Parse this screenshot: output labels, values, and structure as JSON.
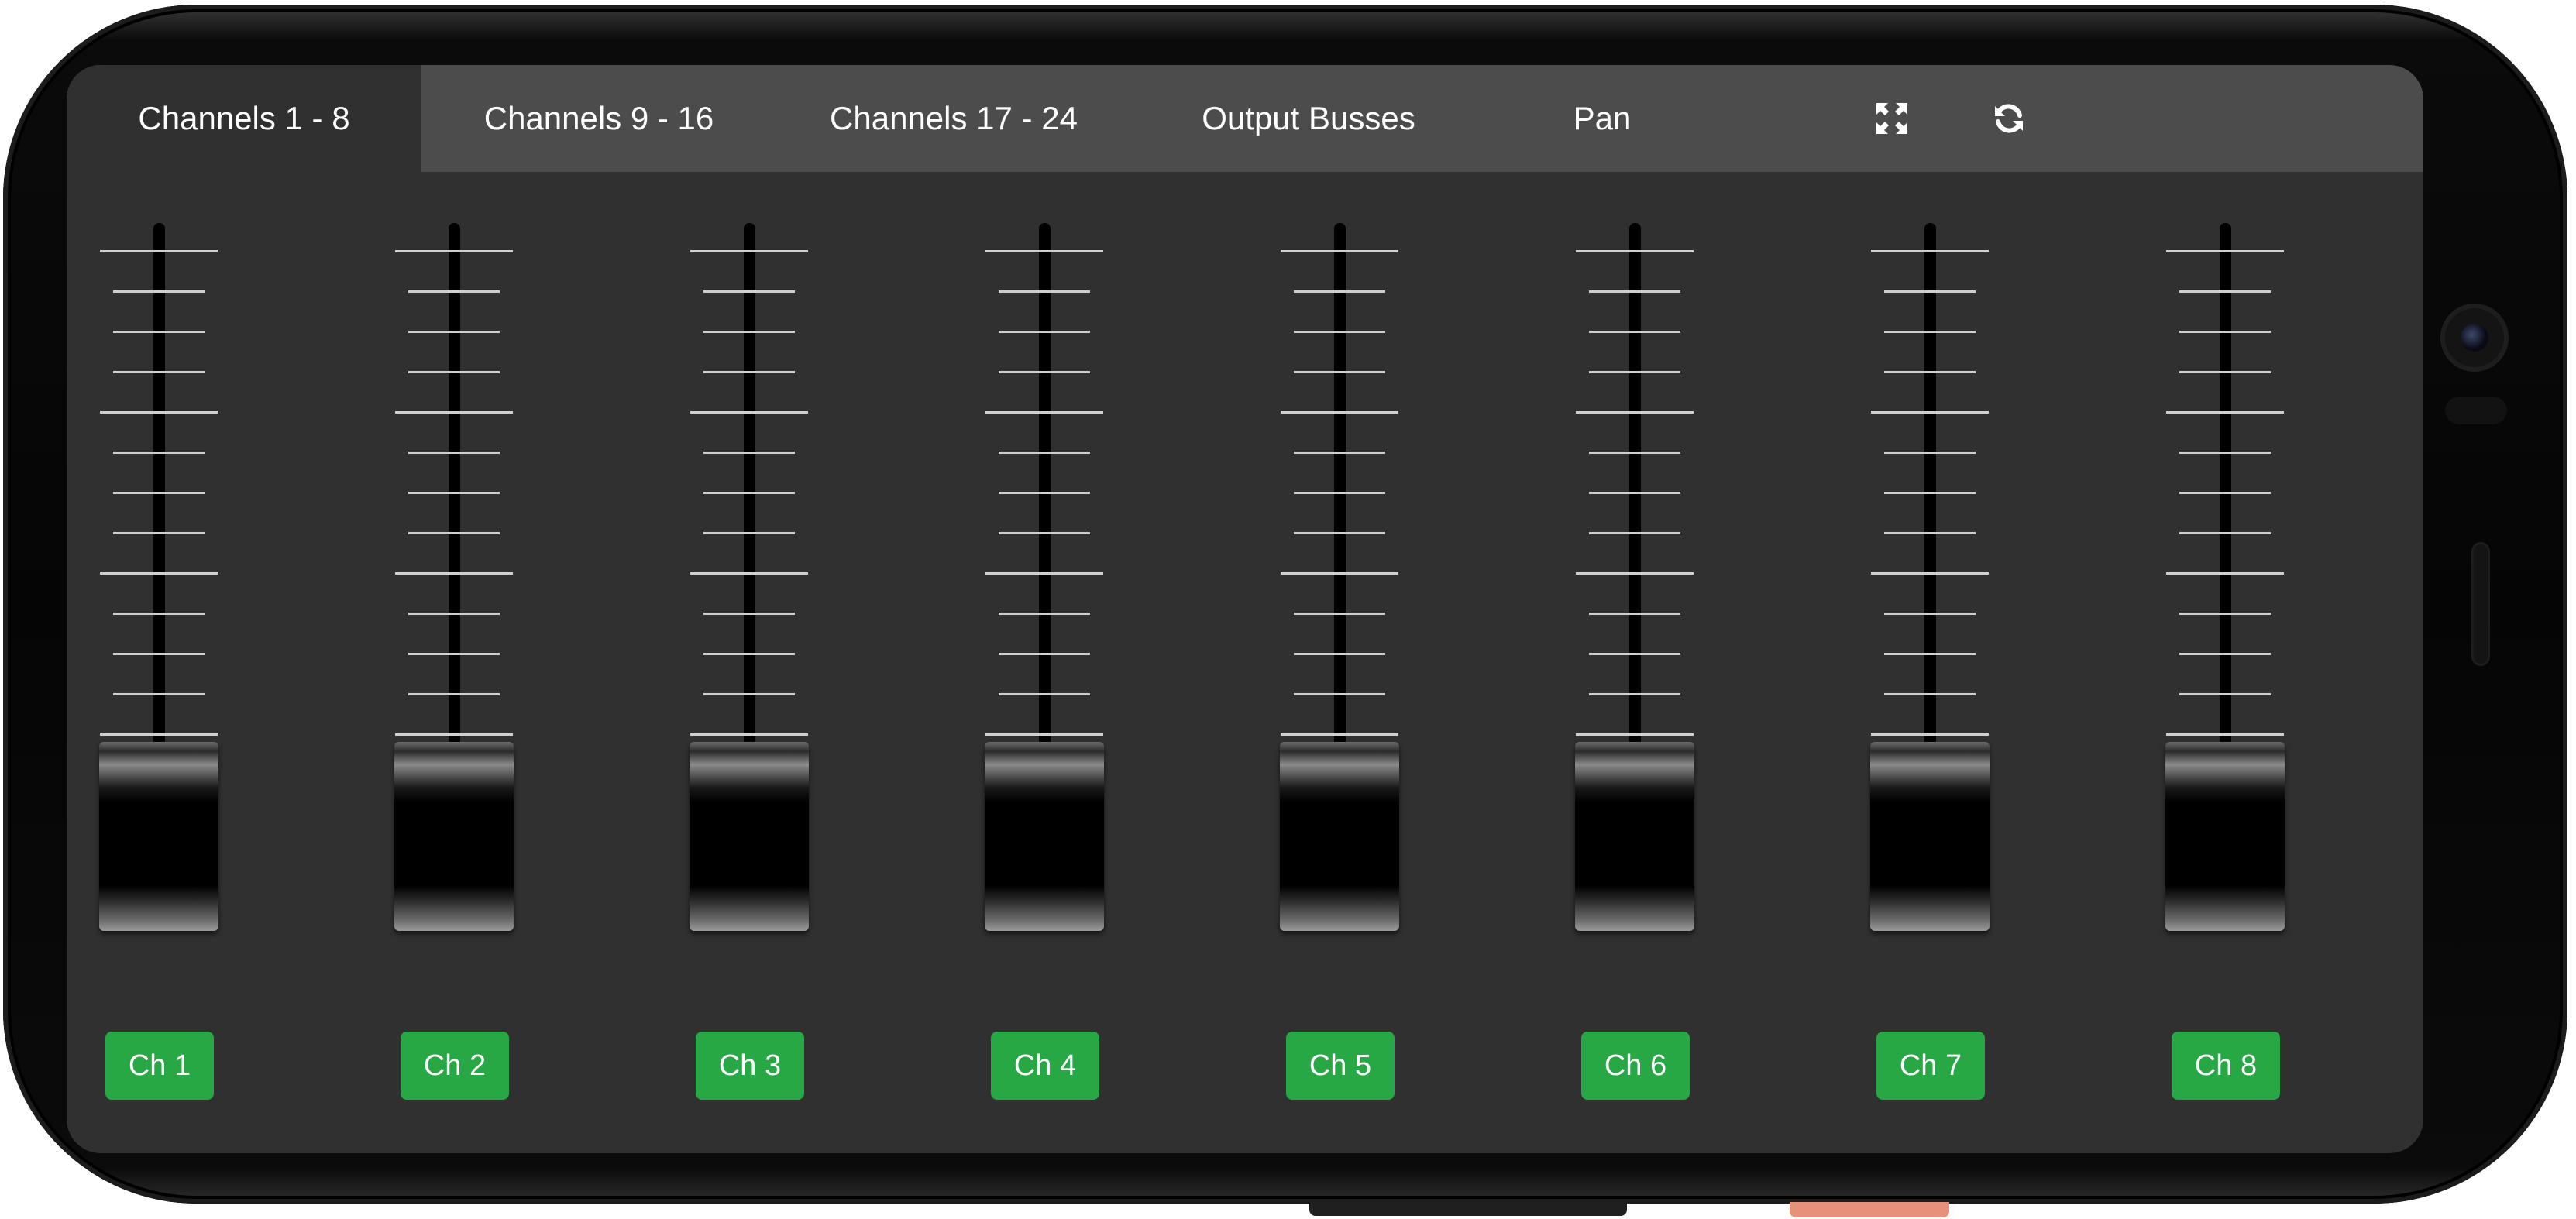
{
  "navbar": {
    "tabs": [
      {
        "label": "Channels 1 - 8",
        "active": true
      },
      {
        "label": "Channels 9 - 16",
        "active": false
      },
      {
        "label": "Channels 17 - 24",
        "active": false
      },
      {
        "label": "Output Busses",
        "active": false
      },
      {
        "label": "Pan",
        "active": false
      }
    ],
    "icons": [
      "fullscreen-icon",
      "refresh-icon"
    ]
  },
  "channels": [
    {
      "label": "Ch 1",
      "fader_level": 0
    },
    {
      "label": "Ch 2",
      "fader_level": 0
    },
    {
      "label": "Ch 3",
      "fader_level": 0
    },
    {
      "label": "Ch 4",
      "fader_level": 0
    },
    {
      "label": "Ch 5",
      "fader_level": 0
    },
    {
      "label": "Ch 6",
      "fader_level": 0
    },
    {
      "label": "Ch 7",
      "fader_level": 0
    },
    {
      "label": "Ch 8",
      "fader_level": 0
    }
  ],
  "colors": {
    "screen_bg": "#303030",
    "navbar_bg": "#4c4c4c",
    "channel_button": "#27a844",
    "tick": "#cfcfcf"
  }
}
